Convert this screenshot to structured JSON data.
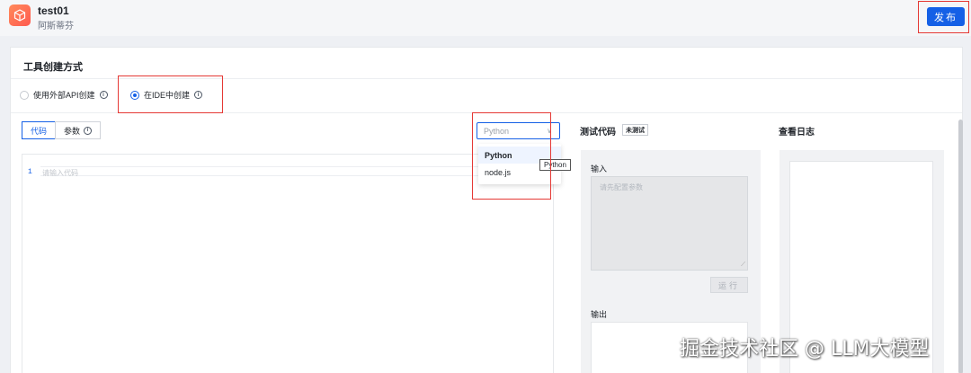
{
  "header": {
    "app_name": "test01",
    "app_owner": "阿斯蒂芬",
    "publish_label": "发布"
  },
  "tool_creation": {
    "title": "工具创建方式",
    "options": [
      {
        "label": "使用外部API创建",
        "selected": false
      },
      {
        "label": "在IDE中创建",
        "selected": true
      }
    ]
  },
  "editor": {
    "tabs": [
      {
        "label": "代码",
        "active": true
      },
      {
        "label": "参数",
        "active": false
      }
    ],
    "language_select": {
      "value": "Python",
      "options": [
        "Python",
        "node.js"
      ],
      "tooltip": "Python"
    },
    "line_number": "1",
    "placeholder": "请输入代码"
  },
  "test_code": {
    "title": "测试代码",
    "status_badge": "未测试",
    "input_label": "输入",
    "input_placeholder": "请先配置参数",
    "run_label": "运行",
    "output_label": "输出"
  },
  "logs": {
    "title": "查看日志"
  },
  "watermark": "掘金技术社区 @ LLM大模型",
  "colors": {
    "primary": "#1560e6",
    "highlight_box": "#e53935"
  }
}
